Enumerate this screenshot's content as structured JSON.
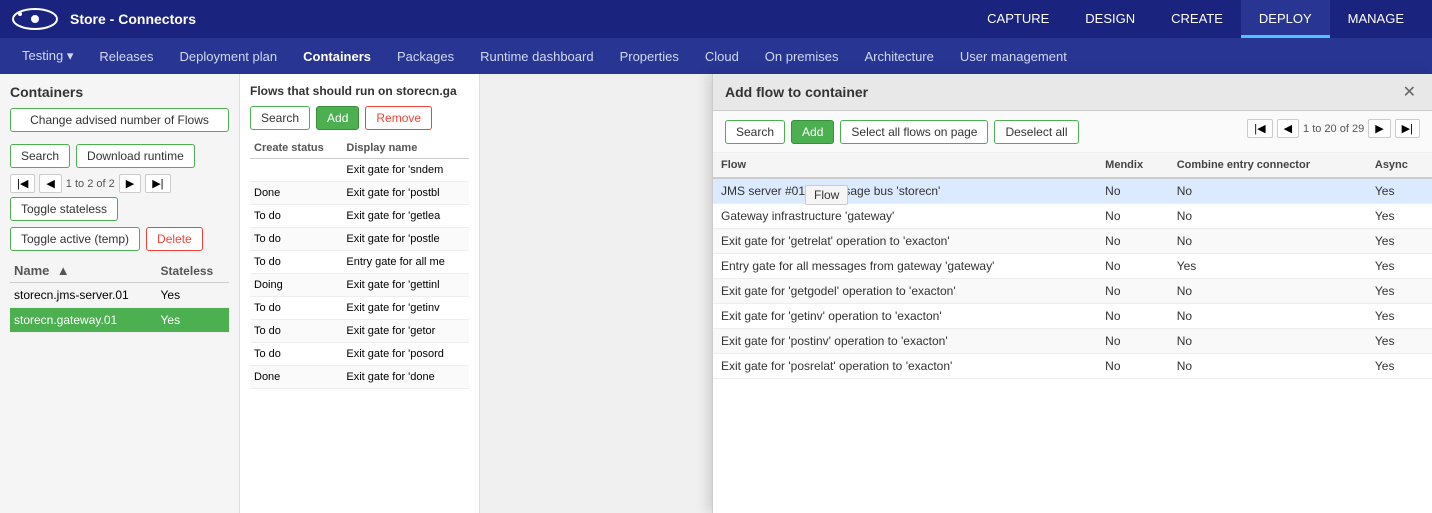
{
  "app": {
    "title": "Store - Connectors",
    "logo_text": "★"
  },
  "top_nav": {
    "links": [
      {
        "label": "CAPTURE",
        "active": false
      },
      {
        "label": "DESIGN",
        "active": false
      },
      {
        "label": "CREATE",
        "active": false
      },
      {
        "label": "DEPLOY",
        "active": true
      },
      {
        "label": "MANAGE",
        "active": false
      }
    ]
  },
  "second_nav": {
    "links": [
      {
        "label": "Testing",
        "dropdown": true,
        "active": false
      },
      {
        "label": "Releases",
        "active": false
      },
      {
        "label": "Deployment plan",
        "active": false
      },
      {
        "label": "Containers",
        "active": true
      },
      {
        "label": "Packages",
        "active": false
      },
      {
        "label": "Runtime dashboard",
        "active": false
      },
      {
        "label": "Properties",
        "active": false
      },
      {
        "label": "Cloud",
        "active": false
      },
      {
        "label": "On premises",
        "active": false
      },
      {
        "label": "Architecture",
        "active": false
      },
      {
        "label": "User management",
        "active": false
      }
    ]
  },
  "left_panel": {
    "title": "Containers",
    "buttons": {
      "change_advised": "Change advised number of Flows",
      "search": "Search",
      "download_runtime": "Download runtime",
      "toggle_stateless": "Toggle stateless",
      "toggle_active": "Toggle active (temp)",
      "delete": "Delete"
    },
    "pagination": {
      "text": "1 to 2 of 2"
    },
    "table": {
      "headers": [
        "Name",
        "Stateless"
      ],
      "rows": [
        {
          "name": "storecn.jms-server.01",
          "stateless": "Yes",
          "selected": false
        },
        {
          "name": "storecn.gateway.01",
          "stateless": "Yes",
          "selected": true
        }
      ]
    }
  },
  "middle_panel": {
    "title": "Flows that should run on storecn.ga",
    "buttons": {
      "search": "Search",
      "add": "Add",
      "remove": "Remove"
    },
    "table": {
      "headers": [
        "Create status",
        "Display name"
      ],
      "rows": [
        {
          "status": "",
          "name": "Exit gate for 'sndem"
        },
        {
          "status": "Done",
          "name": "Exit gate for 'postbl"
        },
        {
          "status": "To do",
          "name": "Exit gate for 'getlea"
        },
        {
          "status": "To do",
          "name": "Exit gate for 'postle"
        },
        {
          "status": "To do",
          "name": "Entry gate for all me"
        },
        {
          "status": "Doing",
          "name": "Exit gate for 'gettinl"
        },
        {
          "status": "To do",
          "name": "Exit gate for 'getinv"
        },
        {
          "status": "To do",
          "name": "Exit gate for 'getor"
        },
        {
          "status": "To do",
          "name": "Exit gate for 'posord"
        },
        {
          "status": "Done",
          "name": "Exit gate for 'done"
        }
      ]
    }
  },
  "right_panel": {
    "title": "Add flow to container",
    "buttons": {
      "search": "Search",
      "add": "Add",
      "select_all": "Select all flows on page",
      "deselect_all": "Deselect all"
    },
    "pagination": {
      "text": "1 to 20 of 29"
    },
    "table": {
      "headers": [
        "Flow",
        "Mendix",
        "Combine entry connector",
        "Async"
      ],
      "rows": [
        {
          "flow": "JMS server #01 of message bus 'storecn'",
          "mendix": "No",
          "combine": "No",
          "async": "Yes"
        },
        {
          "flow": "Gateway infrastructure 'gateway'",
          "mendix": "No",
          "combine": "No",
          "async": "Yes"
        },
        {
          "flow": "Exit gate for 'getrelat' operation to 'exacton'",
          "mendix": "No",
          "combine": "No",
          "async": "Yes"
        },
        {
          "flow": "Entry gate for all messages from gateway 'gateway'",
          "mendix": "No",
          "combine": "Yes",
          "async": "Yes"
        },
        {
          "flow": "Exit gate for 'getgodel' operation to 'exacton'",
          "mendix": "No",
          "combine": "No",
          "async": "Yes"
        },
        {
          "flow": "Exit gate for 'getinv' operation to 'exacton'",
          "mendix": "No",
          "combine": "No",
          "async": "Yes"
        },
        {
          "flow": "Exit gate for 'postinv' operation to 'exacton'",
          "mendix": "No",
          "combine": "No",
          "async": "Yes"
        },
        {
          "flow": "Exit gate for 'posrelat' operation to 'exacton'",
          "mendix": "No",
          "combine": "No",
          "async": "Yes"
        }
      ]
    },
    "tooltip": "Flow"
  }
}
